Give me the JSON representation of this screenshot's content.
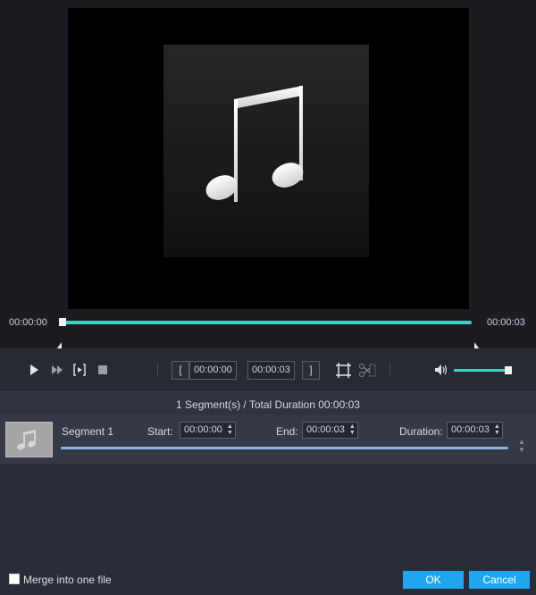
{
  "player": {
    "current_time": "00:00:00",
    "total_time": "00:00:03",
    "progress": 0.0,
    "volume": 0.95
  },
  "clip": {
    "start_time": "00:00:00",
    "end_time": "00:00:03",
    "start_bracket": "[",
    "end_bracket": "]"
  },
  "summary": "1 Segment(s) / Total Duration 00:00:03",
  "segment": {
    "name": "Segment 1",
    "start_label": "Start:",
    "start_value": "00:00:00",
    "end_label": "End:",
    "end_value": "00:00:03",
    "duration_label": "Duration:",
    "duration_value": "00:00:03"
  },
  "footer": {
    "merge_label": "Merge into one file",
    "merge_checked": false,
    "ok_label": "OK",
    "cancel_label": "Cancel"
  },
  "colors": {
    "accent": "#3ad1c2",
    "button": "#1ea7f0",
    "segment_bar": "#8fb0e6"
  },
  "icons": [
    "music-note-icon",
    "play-icon",
    "fast-forward-icon",
    "step-frame-icon",
    "stop-icon",
    "crop-icon",
    "scissors-icon",
    "speaker-icon"
  ]
}
